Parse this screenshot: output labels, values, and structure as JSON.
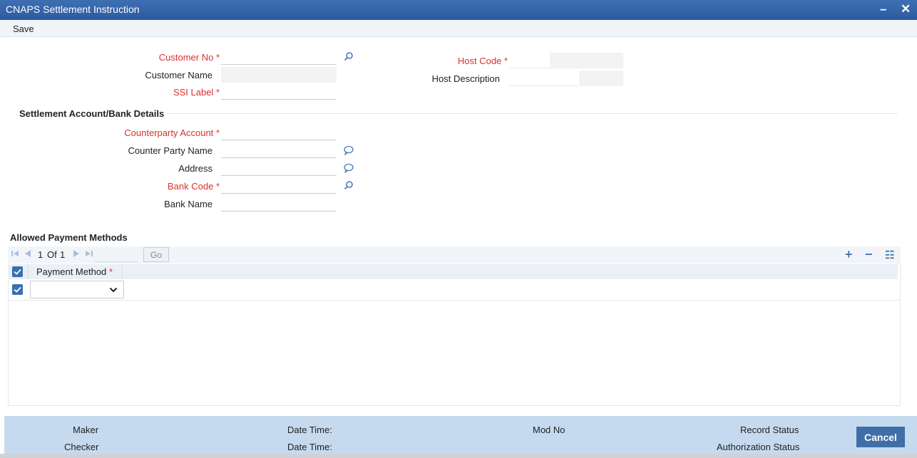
{
  "window": {
    "title": "CNAPS Settlement Instruction",
    "minimize_label": "–",
    "close_label": "✕"
  },
  "toolbar": {
    "save_label": "Save"
  },
  "form": {
    "customer_no": {
      "label": "Customer No",
      "value": "",
      "required": "*"
    },
    "customer_name": {
      "label": "Customer Name",
      "value": ""
    },
    "ssi_label": {
      "label": "SSI Label",
      "value": "",
      "required": "*"
    },
    "host_code": {
      "label": "Host Code",
      "value": "",
      "required": "*"
    },
    "host_description": {
      "label": "Host Description",
      "value": ""
    }
  },
  "settlement": {
    "title": "Settlement Account/Bank Details",
    "counterparty_account": {
      "label": "Counterparty Account",
      "value": "",
      "required": "*"
    },
    "counter_party_name": {
      "label": "Counter Party Name",
      "value": ""
    },
    "address": {
      "label": "Address",
      "value": ""
    },
    "bank_code": {
      "label": "Bank Code",
      "value": "",
      "required": "*"
    },
    "bank_name": {
      "label": "Bank Name",
      "value": ""
    }
  },
  "payment_methods": {
    "title": "Allowed Payment Methods",
    "pager": {
      "current": "1",
      "of_label": "Of",
      "total": "1",
      "go_label": "Go"
    },
    "actions": {
      "add": "+",
      "remove": "−",
      "view": "☷"
    },
    "column": {
      "label": "Payment Method",
      "required": "*"
    },
    "rows": [
      {
        "payment_method": ""
      }
    ]
  },
  "footer": {
    "maker": "Maker",
    "checker": "Checker",
    "date_time_1": "Date Time:",
    "date_time_2": "Date Time:",
    "mod_no": "Mod No",
    "record_status": "Record Status",
    "authorization_status": "Authorization Status",
    "cancel_label": "Cancel"
  },
  "colors": {
    "title_bar": "#2c5a9e",
    "required": "#d8322e",
    "footer": "#c5daef",
    "button": "#3f6fa6"
  }
}
